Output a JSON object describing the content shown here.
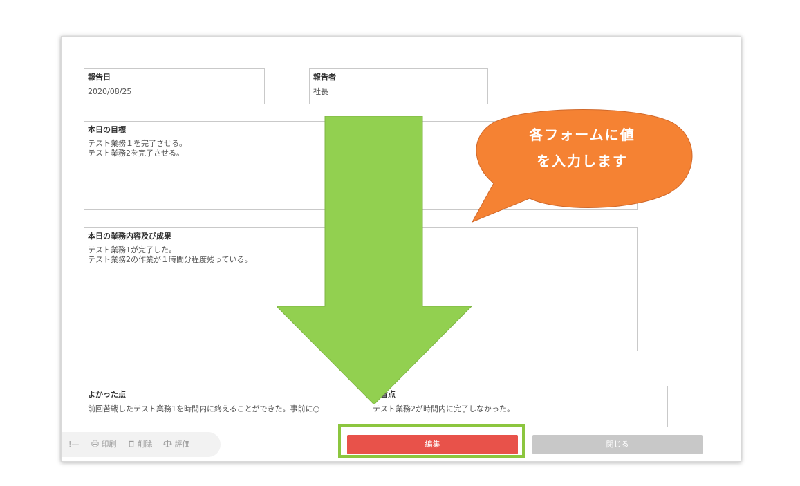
{
  "form": {
    "report_date": {
      "label": "報告日",
      "value": "2020/08/25"
    },
    "reporter": {
      "label": "報告者",
      "value": "社長"
    },
    "today_goal": {
      "label": "本日の目標",
      "value": "テスト業務１を完了させる。\nテスト業務2を完了させる。"
    },
    "today_work": {
      "label": "本日の業務内容及び成果",
      "value": "テスト業務1が完了した。\nテスト業務2の作業が１時間分程度残っている。"
    },
    "good_points": {
      "label": "よかった点",
      "value": "前回苦戦したテスト業務1を時間内に終えることができた。事前に○"
    },
    "bad_points": {
      "label": "反省点",
      "value": "テスト業務2が時間内に完了しなかった。"
    }
  },
  "toolbar": {
    "truncated": "!—",
    "print": "印刷",
    "delete": "削除",
    "evaluate": "評価"
  },
  "buttons": {
    "edit": "編集",
    "close": "閉じる"
  },
  "callout": {
    "line1": "各フォームに値",
    "line2": "を入力します"
  },
  "colors": {
    "edit_button": "#e8524a",
    "close_button": "#c8c8c8",
    "highlight_frame": "#8cc63f",
    "arrow": "#92d050",
    "callout": "#f58233"
  },
  "icons": {
    "print": "printer-icon",
    "delete": "trash-icon",
    "evaluate": "scale-icon"
  }
}
